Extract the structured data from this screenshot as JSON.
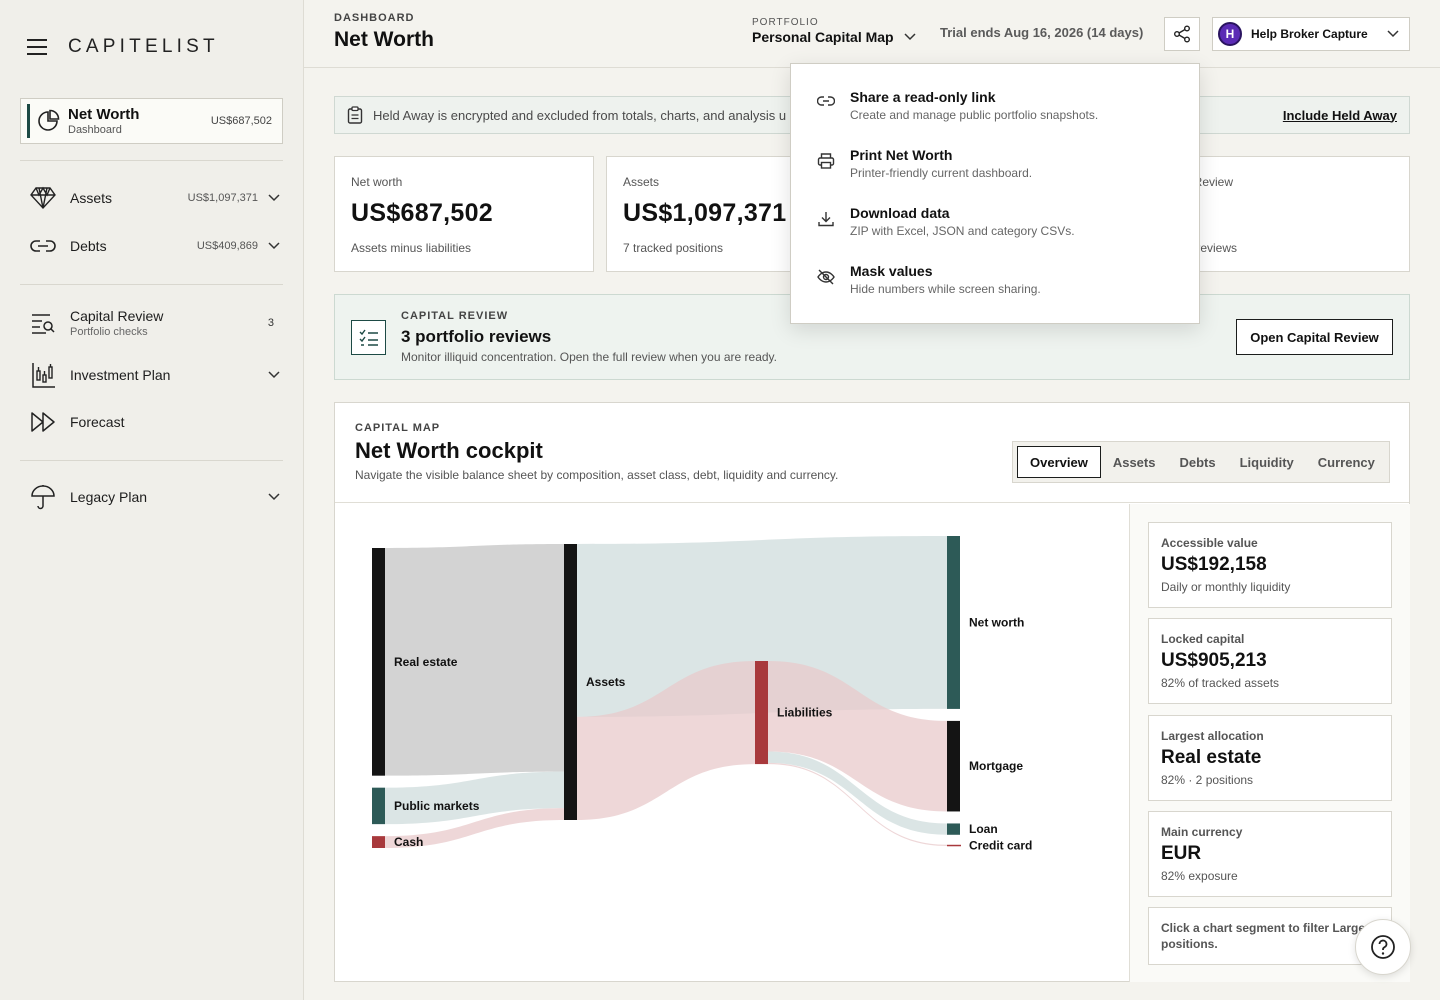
{
  "brand": {
    "name": "CAPITELIST"
  },
  "sidebar": {
    "networth": {
      "label": "Net Worth",
      "sub": "Dashboard",
      "value": "US$687,502"
    },
    "items": [
      {
        "label": "Assets",
        "value": "US$1,097,371",
        "icon": "diamond-icon"
      },
      {
        "label": "Debts",
        "value": "US$409,869",
        "icon": "link-icon"
      },
      {
        "label": "Capital Review",
        "sub": "Portfolio checks",
        "count": "3",
        "icon": "review-icon"
      },
      {
        "label": "Investment Plan",
        "icon": "chart-plan-icon"
      },
      {
        "label": "Forecast",
        "icon": "fast-forward-icon"
      },
      {
        "label": "Legacy Plan",
        "icon": "umbrella-icon"
      }
    ]
  },
  "header": {
    "crumb": "DASHBOARD",
    "title": "Net Worth",
    "portfolio_label": "PORTFOLIO",
    "portfolio_name": "Personal Capital Map",
    "trial": "Trial ends Aug 16, 2026 (14 days)",
    "user_initial": "H",
    "user_name": "Help Broker Capture"
  },
  "banner": {
    "text": "Held Away is encrypted and excluded from totals, charts, and analysis u",
    "link": "Include Held Away"
  },
  "stats": [
    {
      "label": "Net worth",
      "value": "US$687,502",
      "sub": "Assets minus liabilities"
    },
    {
      "label": "Assets",
      "value": "US$1,097,371",
      "sub": "7 tracked positions"
    },
    {
      "label": "al Review",
      "value": "",
      "sub": "lio reviews"
    }
  ],
  "review": {
    "kicker": "CAPITAL REVIEW",
    "title": "3 portfolio reviews",
    "sub": "Monitor illiquid concentration. Open the full review when you are ready.",
    "button": "Open Capital Review"
  },
  "capmap": {
    "kicker": "CAPITAL MAP",
    "title": "Net Worth cockpit",
    "sub": "Navigate the visible balance sheet by composition, asset class, debt, liquidity and currency.",
    "tabs": [
      "Overview",
      "Assets",
      "Debts",
      "Liquidity",
      "Currency"
    ],
    "active_tab": "Overview"
  },
  "chart_data": {
    "type": "sankey",
    "nodes": [
      "Real estate",
      "Public markets",
      "Cash",
      "Assets",
      "Liabilities",
      "Net worth",
      "Mortgage",
      "Loan",
      "Credit card"
    ],
    "links": [
      {
        "source": "Real estate",
        "target": "Assets",
        "value": 905213
      },
      {
        "source": "Public markets",
        "target": "Assets",
        "value": 145000
      },
      {
        "source": "Cash",
        "target": "Assets",
        "value": 47158
      },
      {
        "source": "Assets",
        "target": "Net worth",
        "value": 687502
      },
      {
        "source": "Assets",
        "target": "Liabilities",
        "value": 409869
      },
      {
        "source": "Liabilities",
        "target": "Mortgage",
        "value": 360000
      },
      {
        "source": "Liabilities",
        "target": "Loan",
        "value": 45000
      },
      {
        "source": "Liabilities",
        "target": "Credit card",
        "value": 4869
      }
    ],
    "colors": {
      "dark": "#141414",
      "teal": "#2d5a57",
      "red": "#a8393c",
      "flow_gray": "#c4c4c4",
      "flow_teal": "#cfdcdc",
      "flow_red": "#e8c9cb"
    }
  },
  "metrics": [
    {
      "label": "Accessible value",
      "value": "US$192,158",
      "sub": "Daily or monthly liquidity"
    },
    {
      "label": "Locked capital",
      "value": "US$905,213",
      "sub": "82% of tracked assets"
    },
    {
      "label": "Largest allocation",
      "value": "Real estate",
      "sub": "82% · 2 positions"
    },
    {
      "label": "Main currency",
      "value": "EUR",
      "sub": "82% exposure"
    }
  ],
  "note": "Click a chart segment to filter Largest positions.",
  "menu": [
    {
      "title": "Share a read-only link",
      "sub": "Create and manage public portfolio snapshots.",
      "icon": "link-icon"
    },
    {
      "title": "Print Net Worth",
      "sub": "Printer-friendly current dashboard.",
      "icon": "printer-icon"
    },
    {
      "title": "Download data",
      "sub": "ZIP with Excel, JSON and category CSVs.",
      "icon": "download-icon"
    },
    {
      "title": "Mask values",
      "sub": "Hide numbers while screen sharing.",
      "icon": "eye-off-icon"
    }
  ]
}
